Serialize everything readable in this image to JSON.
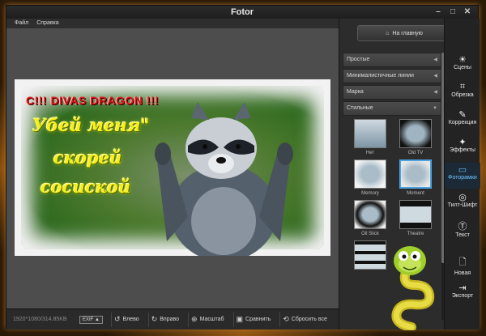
{
  "window": {
    "title": "Fotor"
  },
  "menu": {
    "items": [
      "Файл",
      "Справка"
    ]
  },
  "photo": {
    "caption_red": "С!!! DIVAS DRAGON !!!",
    "caption_lines": [
      "Убей меня\"",
      "скорей",
      "сосиской"
    ]
  },
  "status": {
    "dimensions": "1920*1080/314.85KB",
    "exif": "EXIF ▲"
  },
  "bottom_tools": [
    {
      "icon": "rotate-left-icon",
      "label": "Влево"
    },
    {
      "icon": "rotate-right-icon",
      "label": "Вправо"
    },
    {
      "icon": "zoom-icon",
      "label": "Масштаб"
    },
    {
      "icon": "compare-icon",
      "label": "Сравнить"
    },
    {
      "icon": "reset-icon",
      "label": "Сбросить все"
    }
  ],
  "panel": {
    "home_label": "На главную",
    "categories": [
      {
        "label": "Простые",
        "arrow": "◀"
      },
      {
        "label": "Минималистичные линии",
        "arrow": "◀"
      },
      {
        "label": "Марка",
        "arrow": "◀"
      },
      {
        "label": "Стильные",
        "arrow": "▼"
      }
    ],
    "frames": [
      "Нет",
      "Old TV",
      "Memory",
      "Moment",
      "Oil Slick",
      "Theatre",
      ""
    ]
  },
  "toolbar": {
    "items": [
      {
        "icon": "sun-icon",
        "label": "Сцены"
      },
      {
        "icon": "crop-icon",
        "label": "Обрезка"
      },
      {
        "icon": "brush-icon",
        "label": "Коррекция"
      },
      {
        "icon": "sparkle-icon",
        "label": "Эффекты"
      },
      {
        "icon": "frame-icon",
        "label": "Фоторамки",
        "active": true
      },
      {
        "icon": "tiltshift-icon",
        "label": "Тилт-Шифт"
      },
      {
        "icon": "text-icon",
        "label": "Текст"
      },
      {
        "icon": "new-file-icon",
        "label": "Новая"
      },
      {
        "icon": "export-icon",
        "label": "Экспорт"
      }
    ]
  },
  "colors": {
    "accent": "#6ec3ff",
    "caption_red": "#d81818",
    "caption_yellow": "#f6f01a"
  }
}
